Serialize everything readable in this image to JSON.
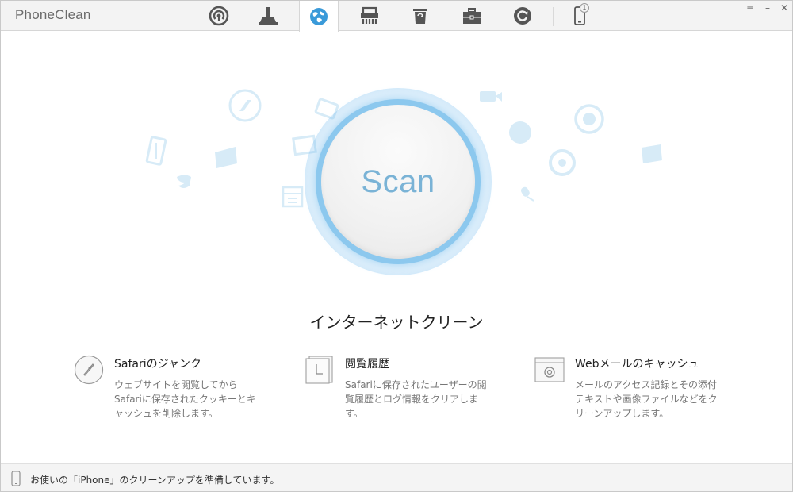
{
  "app": {
    "title": "PhoneClean"
  },
  "tabs": [
    {
      "name": "quick-clean",
      "icon": "broadcast-icon"
    },
    {
      "name": "deep-clean",
      "icon": "broom-icon"
    },
    {
      "name": "internet-clean",
      "icon": "globe-icon",
      "active": true
    },
    {
      "name": "privacy-clean",
      "icon": "shredder-icon"
    },
    {
      "name": "system-clean",
      "icon": "trash-bin-icon"
    },
    {
      "name": "toolbox",
      "icon": "toolbox-icon"
    },
    {
      "name": "restore",
      "icon": "refresh-icon"
    }
  ],
  "device": {
    "count": "1",
    "icon": "iphone-icon"
  },
  "window_controls": {
    "menu": "≡",
    "minimize": "–",
    "close": "✕"
  },
  "scan": {
    "label": "Scan"
  },
  "section": {
    "title": "インターネットクリーン"
  },
  "features": [
    {
      "icon": "compass-icon",
      "title": "Safariのジャンク",
      "desc": "ウェブサイトを閲覧してからSafariに保存されたクッキーとキャッシュを削除します。"
    },
    {
      "icon": "history-icon",
      "title": "閲覧履歴",
      "desc": "Safariに保存されたユーザーの閲覧履歴とログ情報をクリアします。"
    },
    {
      "icon": "webmail-icon",
      "title": "Webメールのキャッシュ",
      "desc": "メールのアクセス記録とその添付テキストや画像ファイルなどをクリーンアップします。"
    }
  ],
  "status": {
    "text": "お使いの「iPhone」のクリーンアップを準備しています。",
    "icon": "phone-outline-icon"
  },
  "colors": {
    "accent": "#3a9ad9",
    "scan_ring": "#8cc8ee",
    "scan_text": "#7ab3d6",
    "decor": "#cfe6f5"
  }
}
